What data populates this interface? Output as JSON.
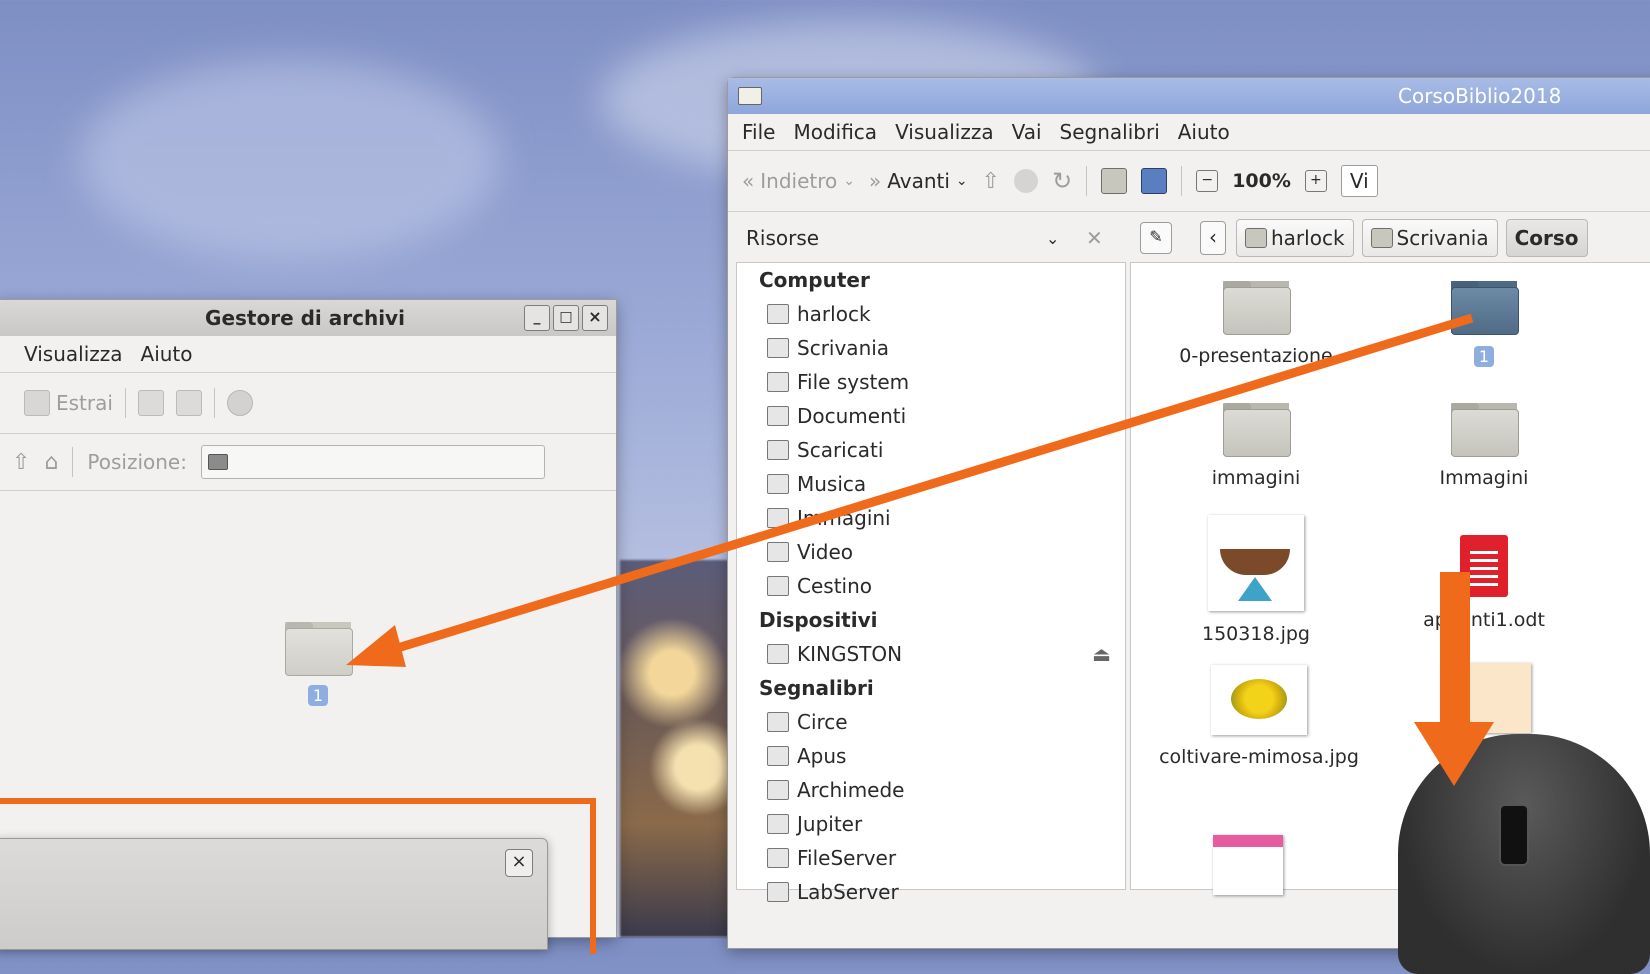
{
  "archive_manager": {
    "title": "Gestore di archivi",
    "menu": [
      "Visualizza",
      "Aiuto"
    ],
    "extract_label": "Estrai",
    "position_label": "Posizione:",
    "folder_badge": "1"
  },
  "file_manager": {
    "title": "CorsoBiblio2018",
    "menu": [
      "File",
      "Modifica",
      "Visualizza",
      "Vai",
      "Segnalibri",
      "Aiuto"
    ],
    "toolbar": {
      "back": "Indietro",
      "forward": "Avanti",
      "zoom": "100%",
      "view": "Vi"
    },
    "sidebar_title": "Risorse",
    "breadcrumbs": [
      "harlock",
      "Scrivania",
      "Corso"
    ],
    "sidebar": {
      "computer_header": "Computer",
      "computer": [
        "harlock",
        "Scrivania",
        "File system",
        "Documenti",
        "Scaricati",
        "Musica",
        "Immagini",
        "Video",
        "Cestino"
      ],
      "devices_header": "Dispositivi",
      "devices": [
        "KINGSTON"
      ],
      "bookmarks_header": "Segnalibri",
      "bookmarks": [
        "Circe",
        "Apus",
        "Archimede",
        "Jupiter",
        "FileServer",
        "LabServer"
      ]
    },
    "files": [
      "0-presentazione",
      "1",
      "immagini",
      "Immagini",
      "150318.jpg",
      "appunti1.odt",
      "coltivare-mimosa.jpg"
    ]
  },
  "annotation": {
    "step_number": "1",
    "arrow_color": "#f06a1c"
  }
}
